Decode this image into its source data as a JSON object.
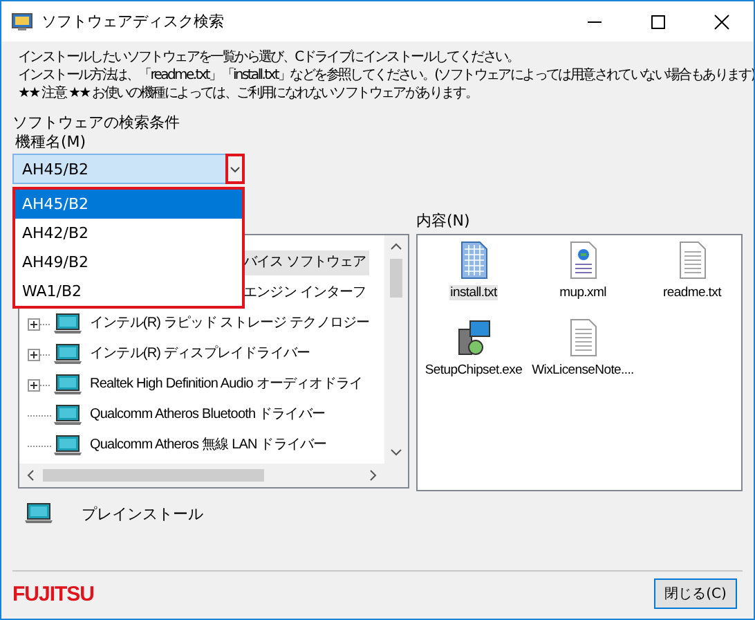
{
  "window": {
    "title": "ソフトウェアディスク検索"
  },
  "instructions": [
    "インストールしたいソフトウェアを一覧から選び、Cドライブにインストールしてください。",
    "インストール方法は、「readme.txt」「install.txt」などを参照してください。(ソフトウェアによっては用意されていない場合もあります)",
    "★★ 注意 ★★ お使いの機種によっては、ご利用になれないソフトウェアがあります。"
  ],
  "search_label": "ソフトウェアの検索条件",
  "model": {
    "label": "機種名(M)",
    "value": "AH45/B2",
    "expanded": true,
    "options": [
      {
        "label": "AH45/B2",
        "selected": true
      },
      {
        "label": "AH42/B2",
        "selected": false
      },
      {
        "label": "AH49/B2",
        "selected": false
      },
      {
        "label": "WA1/B2",
        "selected": false
      }
    ]
  },
  "tree": {
    "items": [
      {
        "kind": "covered",
        "label": "バイス ソフトウェア",
        "selected": true
      },
      {
        "kind": "covered",
        "label": "エンジン インターフ",
        "selected": false
      },
      {
        "kind": "group",
        "label": "インテル(R) ラピッド ストレージ テクノロジー",
        "selected": false
      },
      {
        "kind": "group",
        "label": "インテル(R) ディスプレイドライバー",
        "selected": false
      },
      {
        "kind": "group",
        "label": "Realtek High Definition Audio オーディオドライ",
        "selected": false
      },
      {
        "kind": "leaf",
        "label": "Qualcomm Atheros Bluetooth ドライバー",
        "selected": false
      },
      {
        "kind": "leaf",
        "label": "Qualcomm Atheros 無線 LAN ドライバー",
        "selected": false
      }
    ]
  },
  "contents": {
    "label": "内容(N)",
    "files": [
      {
        "kind": "text",
        "name": "install.txt",
        "selected": true
      },
      {
        "kind": "xml",
        "name": "mup.xml",
        "selected": false
      },
      {
        "kind": "doc",
        "name": "readme.txt",
        "selected": false
      },
      {
        "kind": "exe",
        "name": "SetupChipset.exe",
        "selected": false
      },
      {
        "kind": "doc",
        "name": "WixLicenseNote....",
        "selected": false
      }
    ]
  },
  "preinstall": {
    "label": "プレインストール"
  },
  "footer": {
    "logo": "FUJITSU",
    "close_button": "閉じる(C)"
  }
}
